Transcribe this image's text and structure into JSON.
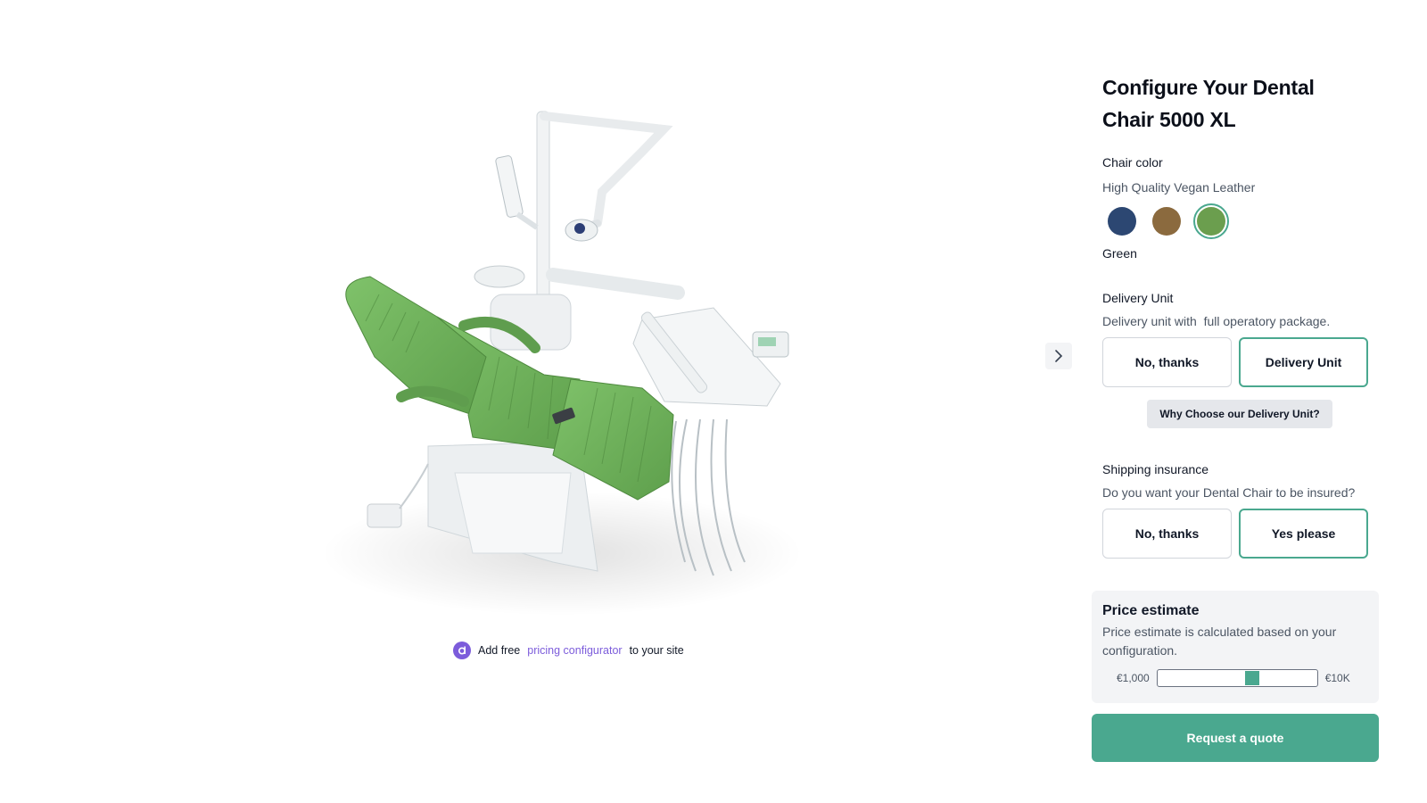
{
  "product": {
    "image_alt": "Dental chair 5000 XL in green",
    "image_icon": "dental-chair-illustration"
  },
  "nav": {
    "next_icon": "chevron-right-icon"
  },
  "promo": {
    "prefix": "Add free",
    "link": "pricing configurator",
    "suffix": "to your site",
    "logo_icon": "configurator-logo-icon"
  },
  "config": {
    "title": "Configure Your Dental Chair 5000 XL",
    "chair_color": {
      "label": "Chair color",
      "description": "High Quality Vegan Leather",
      "swatches": [
        {
          "name": "Navy",
          "hex": "#2c4772"
        },
        {
          "name": "Brown",
          "hex": "#8b6a3e"
        },
        {
          "name": "Green",
          "hex": "#6b9e4e"
        }
      ],
      "selected_index": 2,
      "selected_name": "Green"
    },
    "delivery_unit": {
      "label": "Delivery Unit",
      "description": "Delivery unit with  full operatory package.",
      "options": [
        "No, thanks",
        "Delivery Unit"
      ],
      "selected_index": 1,
      "info_button": "Why Choose our Delivery Unit?"
    },
    "shipping_insurance": {
      "label": "Shipping insurance",
      "description": "Do you want your Dental Chair to be insured?",
      "options": [
        "No, thanks",
        "Yes please"
      ],
      "selected_index": 1
    },
    "price_estimate": {
      "title": "Price estimate",
      "description": "Price estimate is calculated based on your configuration.",
      "min_label": "€1,000",
      "max_label": "€10K",
      "position_fraction": 0.6
    },
    "quote_button": "Request a quote"
  },
  "colors": {
    "accent": "#4aa88f",
    "promo": "#7c5cdb",
    "chair_upholstery": "#6b9e4e"
  }
}
